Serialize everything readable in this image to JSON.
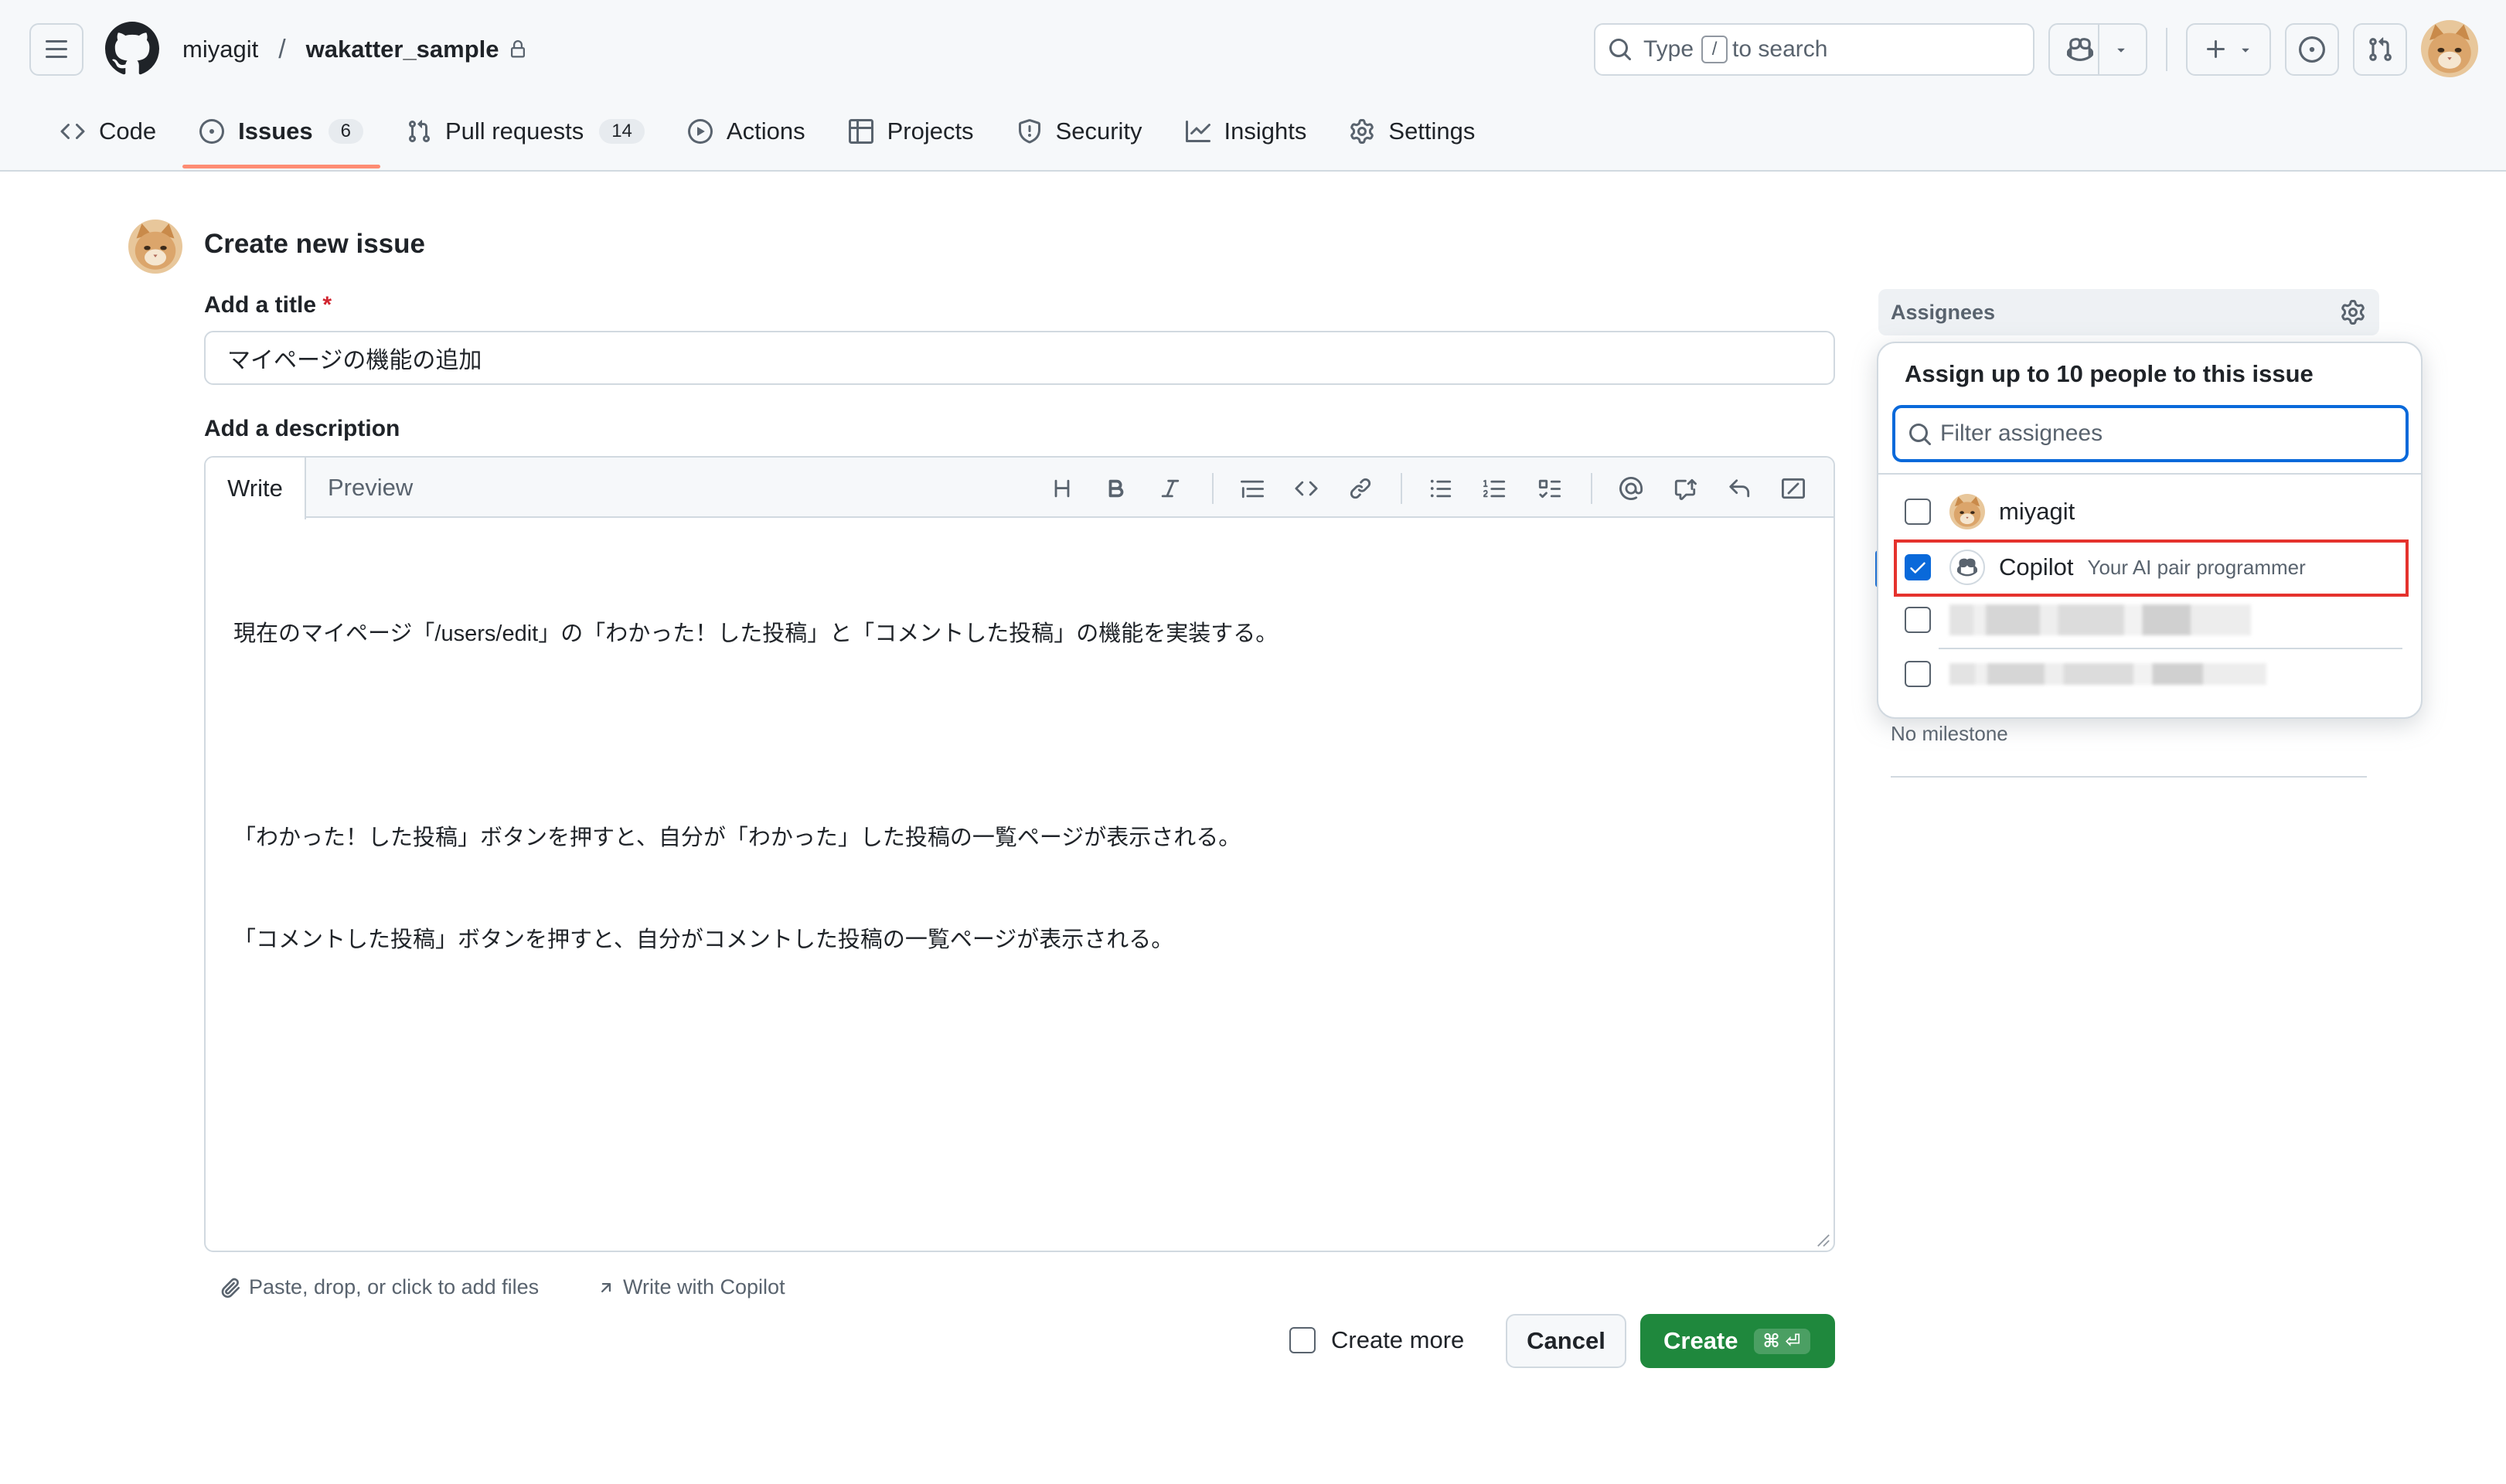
{
  "header": {
    "owner": "miyagit",
    "slash": "/",
    "repo": "wakatter_sample",
    "search": {
      "prefix": "Type",
      "key": "/",
      "suffix": "to search"
    }
  },
  "tabs": [
    {
      "label": "Code",
      "icon": "code-icon"
    },
    {
      "label": "Issues",
      "count": "6",
      "icon": "issue-opened-icon",
      "active": true
    },
    {
      "label": "Pull requests",
      "count": "14",
      "icon": "git-pull-request-icon"
    },
    {
      "label": "Actions",
      "icon": "play-icon"
    },
    {
      "label": "Projects",
      "icon": "table-icon"
    },
    {
      "label": "Security",
      "icon": "shield-icon"
    },
    {
      "label": "Insights",
      "icon": "graph-icon"
    },
    {
      "label": "Settings",
      "icon": "gear-icon"
    }
  ],
  "main": {
    "page_title": "Create new issue",
    "title_label": "Add a title",
    "required_mark": "*",
    "title_value": "マイページの機能の追加",
    "description_label": "Add a description",
    "editor_tabs": {
      "write": "Write",
      "preview": "Preview"
    },
    "description_lines": [
      "現在のマイページ「/users/edit」の「わかった！した投稿」と「コメントした投稿」の機能を実装する。",
      "",
      "「わかった！した投稿」ボタンを押すと、自分が「わかった」した投稿の一覧ページが表示される。",
      "「コメントした投稿」ボタンを押すと、自分がコメントした投稿の一覧ページが表示される。"
    ],
    "attach_hint": "Paste, drop, or click to add files",
    "copilot_hint": "Write with Copilot",
    "create_more": "Create more",
    "cancel": "Cancel",
    "create": "Create",
    "create_shortcut": "⌘ ⏎"
  },
  "sidebar": {
    "assignees_title": "Assignees",
    "popover_title": "Assign up to 10 people to this issue",
    "filter_placeholder": "Filter assignees",
    "users": [
      {
        "name": "miyagit",
        "checked": false
      },
      {
        "name": "Copilot",
        "subtitle": "Your AI pair programmer",
        "checked": true
      }
    ],
    "milestone": "No milestone"
  },
  "colors": {
    "accent": "#0969da",
    "primary_button": "#1f883d",
    "active_tab_underline": "#fd8c73",
    "highlight_box": "#e5322d"
  }
}
